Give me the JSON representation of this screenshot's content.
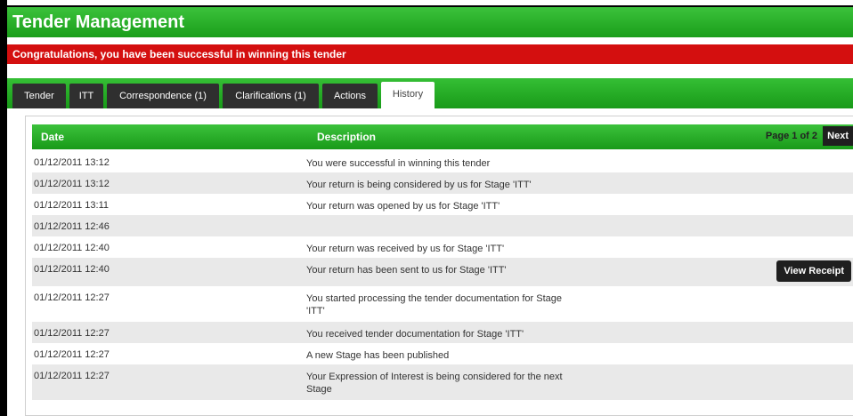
{
  "app": {
    "title": "Tender Management",
    "alert": "Congratulations, you have been successful in winning this tender"
  },
  "tabs": [
    {
      "label": "Tender"
    },
    {
      "label": "ITT"
    },
    {
      "label": "Correspondence (1)"
    },
    {
      "label": "Clarifications (1)"
    },
    {
      "label": "Actions"
    },
    {
      "label": "History",
      "active": true
    }
  ],
  "history": {
    "columns": {
      "date": "Date",
      "description": "Description"
    },
    "pager": {
      "label": "Page 1 of 2",
      "next": "Next"
    },
    "view_receipt_label": "View Receipt",
    "rows": [
      {
        "date": "01/12/2011 13:12",
        "description": "You were successful in winning this tender"
      },
      {
        "date": "01/12/2011 13:12",
        "description": "Your return is being considered by us for Stage 'ITT'"
      },
      {
        "date": "01/12/2011 13:11",
        "description": "Your return was opened by us for Stage 'ITT'"
      },
      {
        "date": "01/12/2011 12:46",
        "description": ""
      },
      {
        "date": "01/12/2011 12:40",
        "description": "Your return was received by us for Stage 'ITT'"
      },
      {
        "date": "01/12/2011 12:40",
        "description": "Your return has been sent to us for Stage 'ITT'"
      },
      {
        "date": "01/12/2011 12:27",
        "description": "You started processing the tender documentation for Stage 'ITT'"
      },
      {
        "date": "01/12/2011 12:27",
        "description": "You received tender documentation for Stage 'ITT'"
      },
      {
        "date": "01/12/2011 12:27",
        "description": "A new Stage has been published"
      },
      {
        "date": "01/12/2011 12:27",
        "description": "Your Expression of Interest is being considered for the next Stage"
      }
    ]
  },
  "colors": {
    "header_green": "#1a9e1a",
    "alert_red": "#d40f0f",
    "tab_dark": "#2f2f2f"
  }
}
